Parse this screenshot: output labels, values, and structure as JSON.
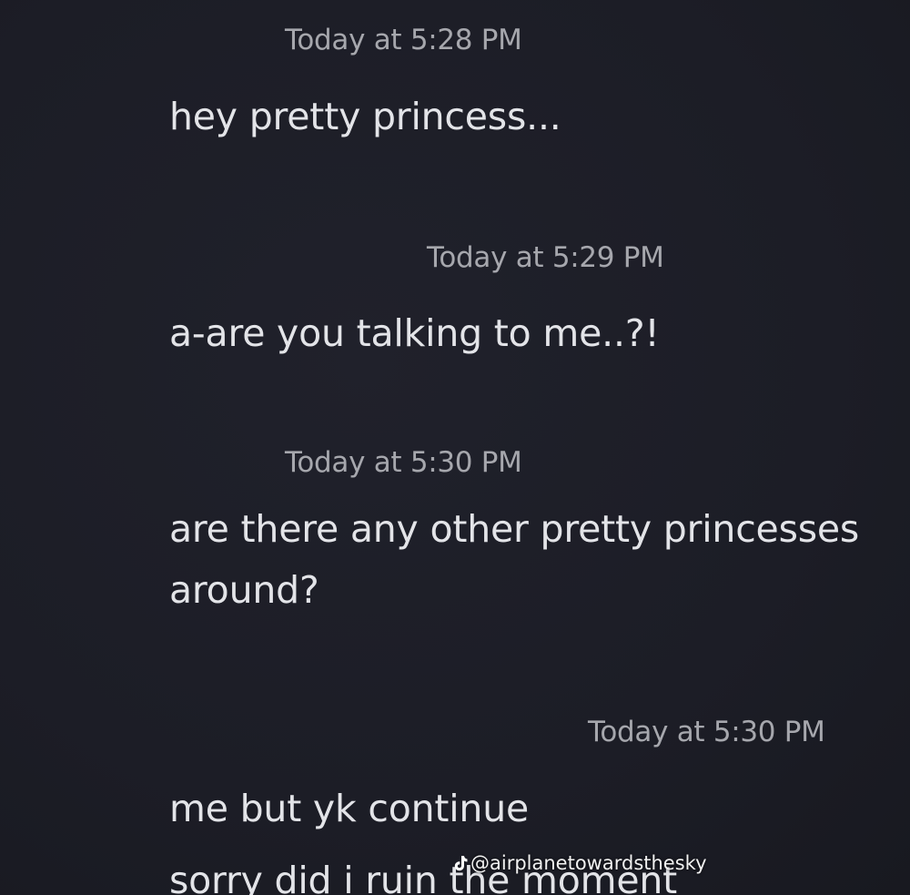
{
  "messages": [
    {
      "timestamp": "Today at 5:28 PM",
      "lines": [
        "hey pretty princess..."
      ]
    },
    {
      "timestamp": "Today at 5:29 PM",
      "lines": [
        "a-are you talking to me..?!"
      ]
    },
    {
      "timestamp": "Today at 5:30 PM",
      "lines": [
        "are there any other pretty princesses",
        "around?"
      ]
    },
    {
      "timestamp": "Today at 5:30 PM",
      "lines": [
        "me but yk continue",
        "sorry did i ruin the moment"
      ]
    }
  ],
  "watermark": {
    "icon": "tiktok-icon",
    "handle": "@airplanetowardsthesky"
  },
  "colors": {
    "background": "#1d1e27",
    "timestamp": "#a6a7ad",
    "message_text": "#e3e4e8"
  }
}
